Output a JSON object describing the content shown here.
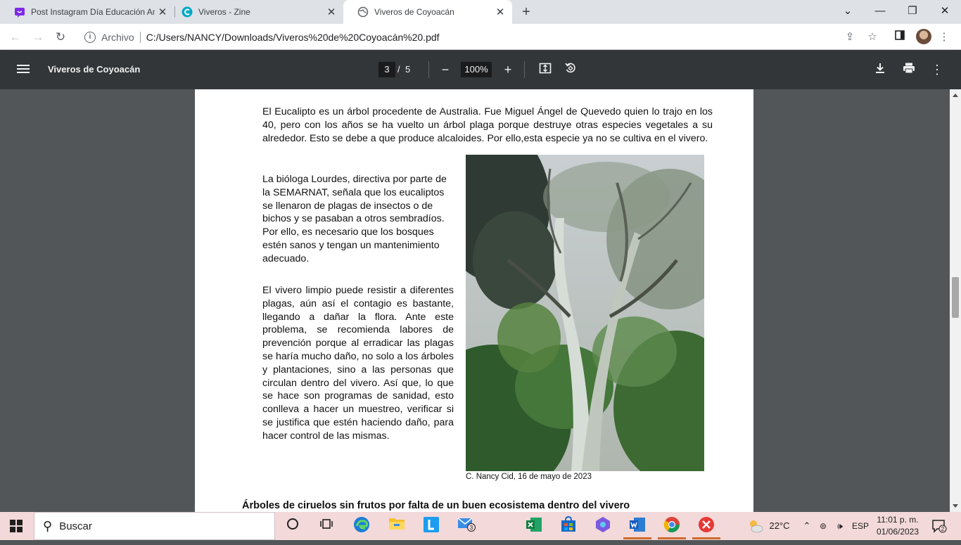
{
  "browser": {
    "tabs": [
      {
        "label": "Post Instagram Día Educación Am",
        "icon": "canva-icon",
        "active": false
      },
      {
        "label": "Viveros - Zine",
        "icon": "canva-c-icon",
        "active": false
      },
      {
        "label": "Viveros de Coyoacán",
        "icon": "globe-icon",
        "active": true
      }
    ],
    "address": {
      "chip": "Archivo",
      "url": "C:/Users/NANCY/Downloads/Viveros%20de%20Coyoacán%20.pdf"
    }
  },
  "pdf": {
    "title": "Viveros de Coyoacán",
    "current_page": "3",
    "separator": "/",
    "total_pages": "5",
    "zoom": "100%"
  },
  "document": {
    "para1": "El Eucalipto  es un árbol procedente de Australia. Fue  Miguel Ángel de Quevedo quien lo trajo en los 40, pero con los años se ha vuelto  un árbol plaga porque destruye otras especies vegetales a su alrededor. Esto se debe a que produce alcaloides. Por ello,esta especie ya no se cultiva en el vivero.",
    "para2": "La bióloga Lourdes, directiva por parte de la SEMARNAT, señala que los eucaliptos se llenaron de plagas de insectos o de bichos y se pasaban a otros sembradíos. Por ello, es necesario que los bosques estén sanos y tengan  un mantenimiento adecuado.",
    "para3": "El vivero limpio puede resistir a diferentes plagas, aún así el contagio es bastante, llegando a dañar la flora. Ante este problema, se recomienda labores de prevención porque al erradicar las plagas se haría mucho daño, no solo a los árboles y plantaciones, sino  a las personas que circulan dentro del vivero. Así que, lo que se hace son programas de sanidad, esto conlleva a hacer un muestreo, verificar si se justifica que estén haciendo daño, para hacer control de las mismas.",
    "caption": "C. Nancy Cid, 16 de mayo de 2023",
    "heading": "Árboles de ciruelos sin frutos por falta de un buen ecosistema dentro del vivero"
  },
  "taskbar": {
    "search_placeholder": "Buscar",
    "mail_badge": "3",
    "weather": "22°C",
    "language": "ESP",
    "time": "11:01 p. m.",
    "date": "01/06/2023",
    "notifications": "2"
  }
}
